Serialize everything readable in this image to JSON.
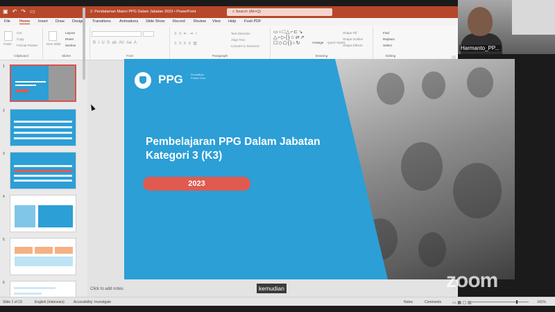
{
  "window": {
    "document_title": "2. Pendalaman Materi PPG Dalam Jabatan 2023 • PowerPoint",
    "search_placeholder": "Search (Alt+Q)",
    "accent": "#b7472a"
  },
  "menu": [
    "File",
    "Home",
    "Insert",
    "Draw",
    "Design",
    "Transitions",
    "Animations",
    "Slide Show",
    "Record",
    "Review",
    "View",
    "Help",
    "Foxit PDF"
  ],
  "ribbon": {
    "groups": [
      "Clipboard",
      "Slides",
      "Font",
      "Paragraph",
      "Drawing",
      "Editing"
    ],
    "clipboard": [
      "Cut",
      "Copy",
      "Format Painter",
      "Paste"
    ],
    "slides": [
      "New Slide",
      "Layout",
      "Reset",
      "Section"
    ],
    "paragraph": [
      "Text Direction",
      "Align Text",
      "Convert to SmartArt"
    ],
    "drawing": [
      "Arrange",
      "Quick Styles",
      "Shape Fill",
      "Shape Outline",
      "Shape Effects"
    ],
    "editing": [
      "Find",
      "Replace",
      "Select"
    ]
  },
  "slide_thumbnails": [
    {
      "number": "1",
      "selected": true
    },
    {
      "number": "2",
      "selected": false
    },
    {
      "number": "3",
      "selected": false
    },
    {
      "number": "4",
      "selected": false
    },
    {
      "number": "5",
      "selected": false
    },
    {
      "number": "6",
      "selected": false
    }
  ],
  "slide": {
    "logo_text": "PPG",
    "logo_subtext": "Pendidikan Profesi Guru",
    "title": "Pembelajaran PPG Dalam Jabatan Kategori 3 (K3)",
    "year": "2023",
    "background_color": "#2b9fd6",
    "pill_color": "#e05a4f"
  },
  "notes_placeholder": "Click to add notes",
  "status": {
    "slide_count": "Slide 1 of 19",
    "language": "English (Indonesia)",
    "accessibility": "Accessibility: Investigate",
    "notes": "Notes",
    "comments": "Comments",
    "zoom": "141%"
  },
  "zoom_meeting": {
    "participant_name": "Harmanto_PP...",
    "caption": "kemudian",
    "watermark": "zoom"
  }
}
